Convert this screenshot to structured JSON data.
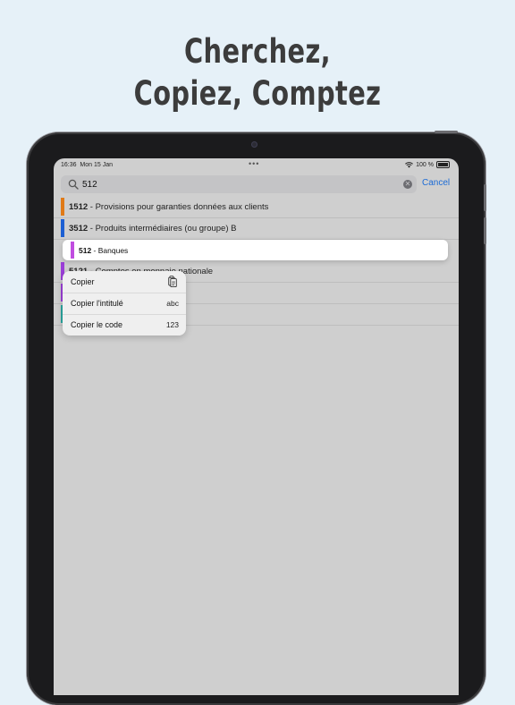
{
  "headline": {
    "line1": "Cherchez,",
    "line2": "Copiez, Comptez"
  },
  "status_bar": {
    "time": "16:36",
    "date": "Mon 15 Jan",
    "dots": "•••",
    "battery_text": "100 %"
  },
  "search": {
    "value": "512",
    "cancel_label": "Cancel",
    "icon": "magnifier-icon",
    "clear_icon": "clear-circle-icon"
  },
  "results": [
    {
      "code": "1512",
      "label": " - Provisions pour garanties données aux clients",
      "color": "#e07a17"
    },
    {
      "code": "3512",
      "label": " - Produits intermédiaires (ou groupe) B",
      "color": "#1c5fd3"
    },
    {
      "code": "5121",
      "label": " - Comptes en monnaie nationale",
      "color": "#9b3ed8"
    },
    {
      "code": "",
      "label": "",
      "color": "#9b3ed8"
    },
    {
      "code": "",
      "label": "",
      "color": "#2aa7a0"
    }
  ],
  "focused": {
    "code": "512",
    "label": " - Banques",
    "color": "#c04de0"
  },
  "context_menu": [
    {
      "label": "Copier",
      "trail": "",
      "icon": "clipboard-icon"
    },
    {
      "label": "Copier l'intitulé",
      "trail": "abc"
    },
    {
      "label": "Copier le code",
      "trail": "123"
    }
  ]
}
